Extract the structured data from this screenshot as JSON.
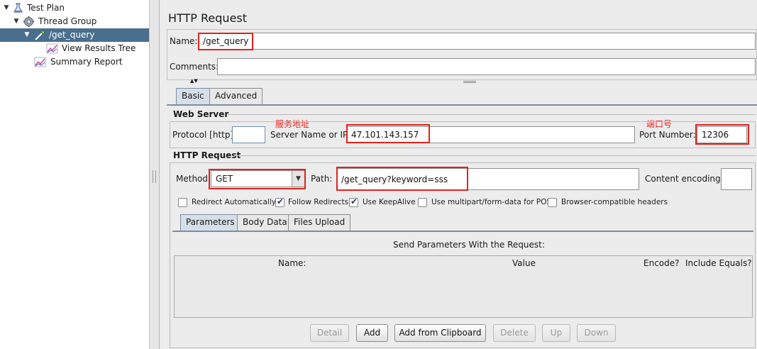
{
  "tree": {
    "test_plan": "Test Plan",
    "thread_group": "Thread Group",
    "get_query": "/get_query",
    "view_results_tree": "View Results Tree",
    "summary_report": "Summary Report"
  },
  "panel": {
    "title": "HTTP Request",
    "name_label": "Name:",
    "name_value": "/get_query",
    "comments_label": "Comments:",
    "comments_value": "",
    "tabs": [
      "Basic",
      "Advanced"
    ],
    "web_server": {
      "heading": "Web Server",
      "protocol_label": "Protocol [http]:",
      "protocol_value": "",
      "server_label": "Server Name or IP:",
      "server_value": "47.101.143.157",
      "port_label": "Port Number:",
      "port_value": "12306",
      "annotation_server": "服务地址",
      "annotation_port": "端口号"
    },
    "http_request": {
      "heading": "HTTP Request",
      "method_label": "Method:",
      "method_value": "GET",
      "path_label": "Path:",
      "path_value": "/get_query?keyword=sss",
      "encoding_label": "Content encoding:",
      "encoding_value": ""
    },
    "options": [
      {
        "label": "Redirect Automatically",
        "checked": false
      },
      {
        "label": "Follow Redirects",
        "checked": true
      },
      {
        "label": "Use KeepAlive",
        "checked": true
      },
      {
        "label": "Use multipart/form-data for POST",
        "checked": false
      },
      {
        "label": "Browser-compatible headers",
        "checked": false
      }
    ],
    "sub_tabs": [
      "Parameters",
      "Body Data",
      "Files Upload"
    ],
    "params": {
      "caption": "Send Parameters With the Request:",
      "columns": [
        "Name:",
        "Value",
        "Encode?",
        "Include Equals?"
      ]
    },
    "buttons": {
      "detail": "Detail",
      "add": "Add",
      "add_clipboard": "Add from Clipboard",
      "delete": "Delete",
      "up": "Up",
      "down": "Down"
    }
  },
  "colors": {
    "annotation": "#e0231d",
    "selection": "#4a6e8e",
    "active_tab": "#d6dfe9"
  }
}
